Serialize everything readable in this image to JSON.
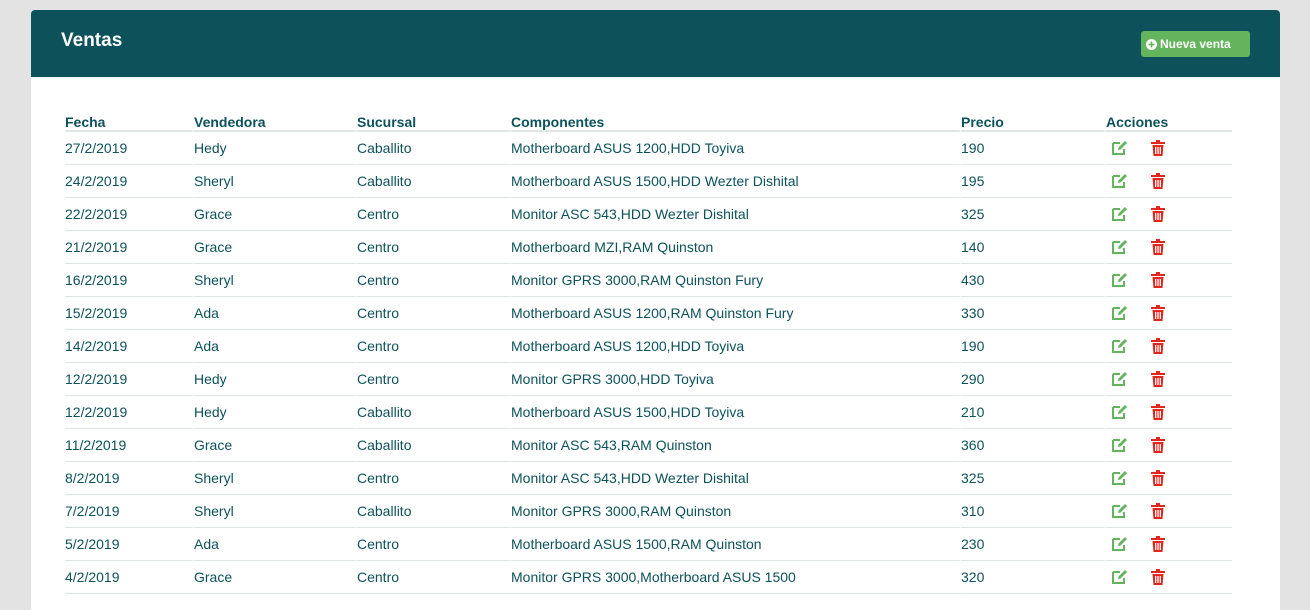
{
  "header": {
    "title": "Ventas",
    "new_sale_label": "Nueva venta"
  },
  "table": {
    "columns": [
      "Fecha",
      "Vendedora",
      "Sucursal",
      "Componentes",
      "Precio",
      "Acciones"
    ],
    "rows": [
      {
        "fecha": "27/2/2019",
        "vendedora": "Hedy",
        "sucursal": "Caballito",
        "componentes": "Motherboard ASUS 1200,HDD Toyiva",
        "precio": "190"
      },
      {
        "fecha": "24/2/2019",
        "vendedora": "Sheryl",
        "sucursal": "Caballito",
        "componentes": "Motherboard ASUS 1500,HDD Wezter Dishital",
        "precio": "195"
      },
      {
        "fecha": "22/2/2019",
        "vendedora": "Grace",
        "sucursal": "Centro",
        "componentes": "Monitor ASC 543,HDD Wezter Dishital",
        "precio": "325"
      },
      {
        "fecha": "21/2/2019",
        "vendedora": "Grace",
        "sucursal": "Centro",
        "componentes": "Motherboard MZI,RAM Quinston",
        "precio": "140"
      },
      {
        "fecha": "16/2/2019",
        "vendedora": "Sheryl",
        "sucursal": "Centro",
        "componentes": "Monitor GPRS 3000,RAM Quinston Fury",
        "precio": "430"
      },
      {
        "fecha": "15/2/2019",
        "vendedora": "Ada",
        "sucursal": "Centro",
        "componentes": "Motherboard ASUS 1200,RAM Quinston Fury",
        "precio": "330"
      },
      {
        "fecha": "14/2/2019",
        "vendedora": "Ada",
        "sucursal": "Centro",
        "componentes": "Motherboard ASUS 1200,HDD Toyiva",
        "precio": "190"
      },
      {
        "fecha": "12/2/2019",
        "vendedora": "Hedy",
        "sucursal": "Centro",
        "componentes": "Monitor GPRS 3000,HDD Toyiva",
        "precio": "290"
      },
      {
        "fecha": "12/2/2019",
        "vendedora": "Hedy",
        "sucursal": "Caballito",
        "componentes": "Motherboard ASUS 1500,HDD Toyiva",
        "precio": "210"
      },
      {
        "fecha": "11/2/2019",
        "vendedora": "Grace",
        "sucursal": "Caballito",
        "componentes": "Monitor ASC 543,RAM Quinston",
        "precio": "360"
      },
      {
        "fecha": "8/2/2019",
        "vendedora": "Sheryl",
        "sucursal": "Centro",
        "componentes": "Monitor ASC 543,HDD Wezter Dishital",
        "precio": "325"
      },
      {
        "fecha": "7/2/2019",
        "vendedora": "Sheryl",
        "sucursal": "Caballito",
        "componentes": "Monitor GPRS 3000,RAM Quinston",
        "precio": "310"
      },
      {
        "fecha": "5/2/2019",
        "vendedora": "Ada",
        "sucursal": "Centro",
        "componentes": "Motherboard ASUS 1500,RAM Quinston",
        "precio": "230"
      },
      {
        "fecha": "4/2/2019",
        "vendedora": "Grace",
        "sucursal": "Centro",
        "componentes": "Monitor GPRS 3000,Motherboard ASUS 1500",
        "precio": "320"
      }
    ]
  },
  "icons": {
    "new_sale": "plus-circle-icon",
    "edit": "edit-icon",
    "delete": "trash-icon"
  },
  "colors": {
    "header_bg": "#0d525b",
    "text": "#0d525b",
    "accent_green": "#63b45c",
    "delete_red": "#e0261d",
    "page_bg": "#e3e3e3"
  }
}
